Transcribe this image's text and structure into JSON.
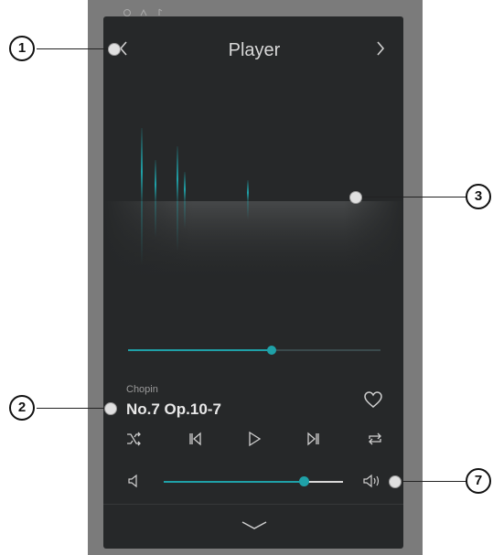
{
  "header": {
    "title": "Player",
    "prev_icon": "chevron-left-icon",
    "next_icon": "chevron-right-icon"
  },
  "playback": {
    "progress_fraction": 0.57
  },
  "track": {
    "composer": "Chopin",
    "title": "No.7 Op.10-7",
    "favorite_icon": "heart-icon"
  },
  "controls": {
    "shuffle_icon": "shuffle-icon",
    "previous_icon": "skip-previous-icon",
    "play_icon": "play-icon",
    "next_icon": "skip-next-icon",
    "repeat_icon": "repeat-icon"
  },
  "volume": {
    "level_fraction": 0.78,
    "low_icon": "volume-low-icon",
    "high_icon": "volume-high-icon"
  },
  "footer": {
    "collapse_icon": "chevron-down-icon"
  },
  "callouts": [
    "1",
    "2",
    "3",
    "7"
  ],
  "colors": {
    "accent": "#1fa1a8",
    "panel": "#262829",
    "text": "#d8d8d8"
  }
}
